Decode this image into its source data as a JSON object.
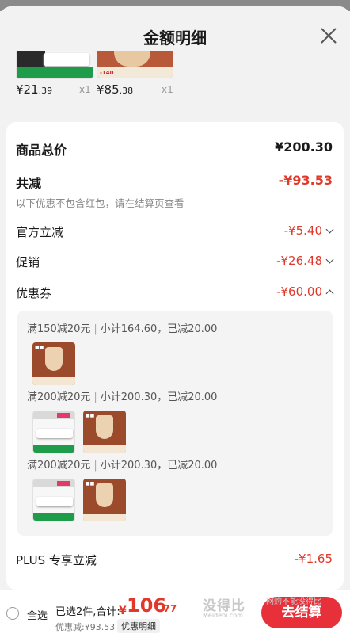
{
  "header": {
    "title": "金额明细"
  },
  "products": [
    {
      "price_main": "¥21",
      "price_dec": ".39",
      "qty": "x1"
    },
    {
      "price_main": "¥85",
      "price_dec": ".38",
      "qty": "x1"
    }
  ],
  "summary": {
    "goods_total_label": "商品总价",
    "goods_total_value": "¥200.30",
    "discount_label": "共减",
    "discount_value": "-¥93.53",
    "discount_note": "以下优惠不包含红包，请在结算页查看",
    "official_label": "官方立减",
    "official_value": "-¥5.40",
    "promo_label": "促销",
    "promo_value": "-¥26.48",
    "coupon_label": "优惠券",
    "coupon_value": "-¥60.00",
    "plus_label": "PLUS 专享立减",
    "plus_value": "-¥1.65"
  },
  "coupons": [
    {
      "rule": "满150减20元",
      "subtotal": "小计164.60，已减20.00"
    },
    {
      "rule": "满200减20元",
      "subtotal": "小计200.30，已减20.00"
    },
    {
      "rule": "满200减20元",
      "subtotal": "小计200.30，已减20.00"
    }
  ],
  "bottom": {
    "select_all": "全选",
    "selected_summary": "已选2件,合计:",
    "total_symbol": "¥",
    "total_int": "106",
    "total_dec": ".77",
    "discount_sub": "优惠减:¥93.53",
    "detail_button": "优惠明细",
    "checkout_button": "去结算"
  },
  "watermark": {
    "text1": "没得比",
    "text2": "Meidebi.com",
    "text3": "网购不能没得比"
  },
  "colors": {
    "accent_red": "#e0392b",
    "checkout_red": "#e8303a"
  }
}
